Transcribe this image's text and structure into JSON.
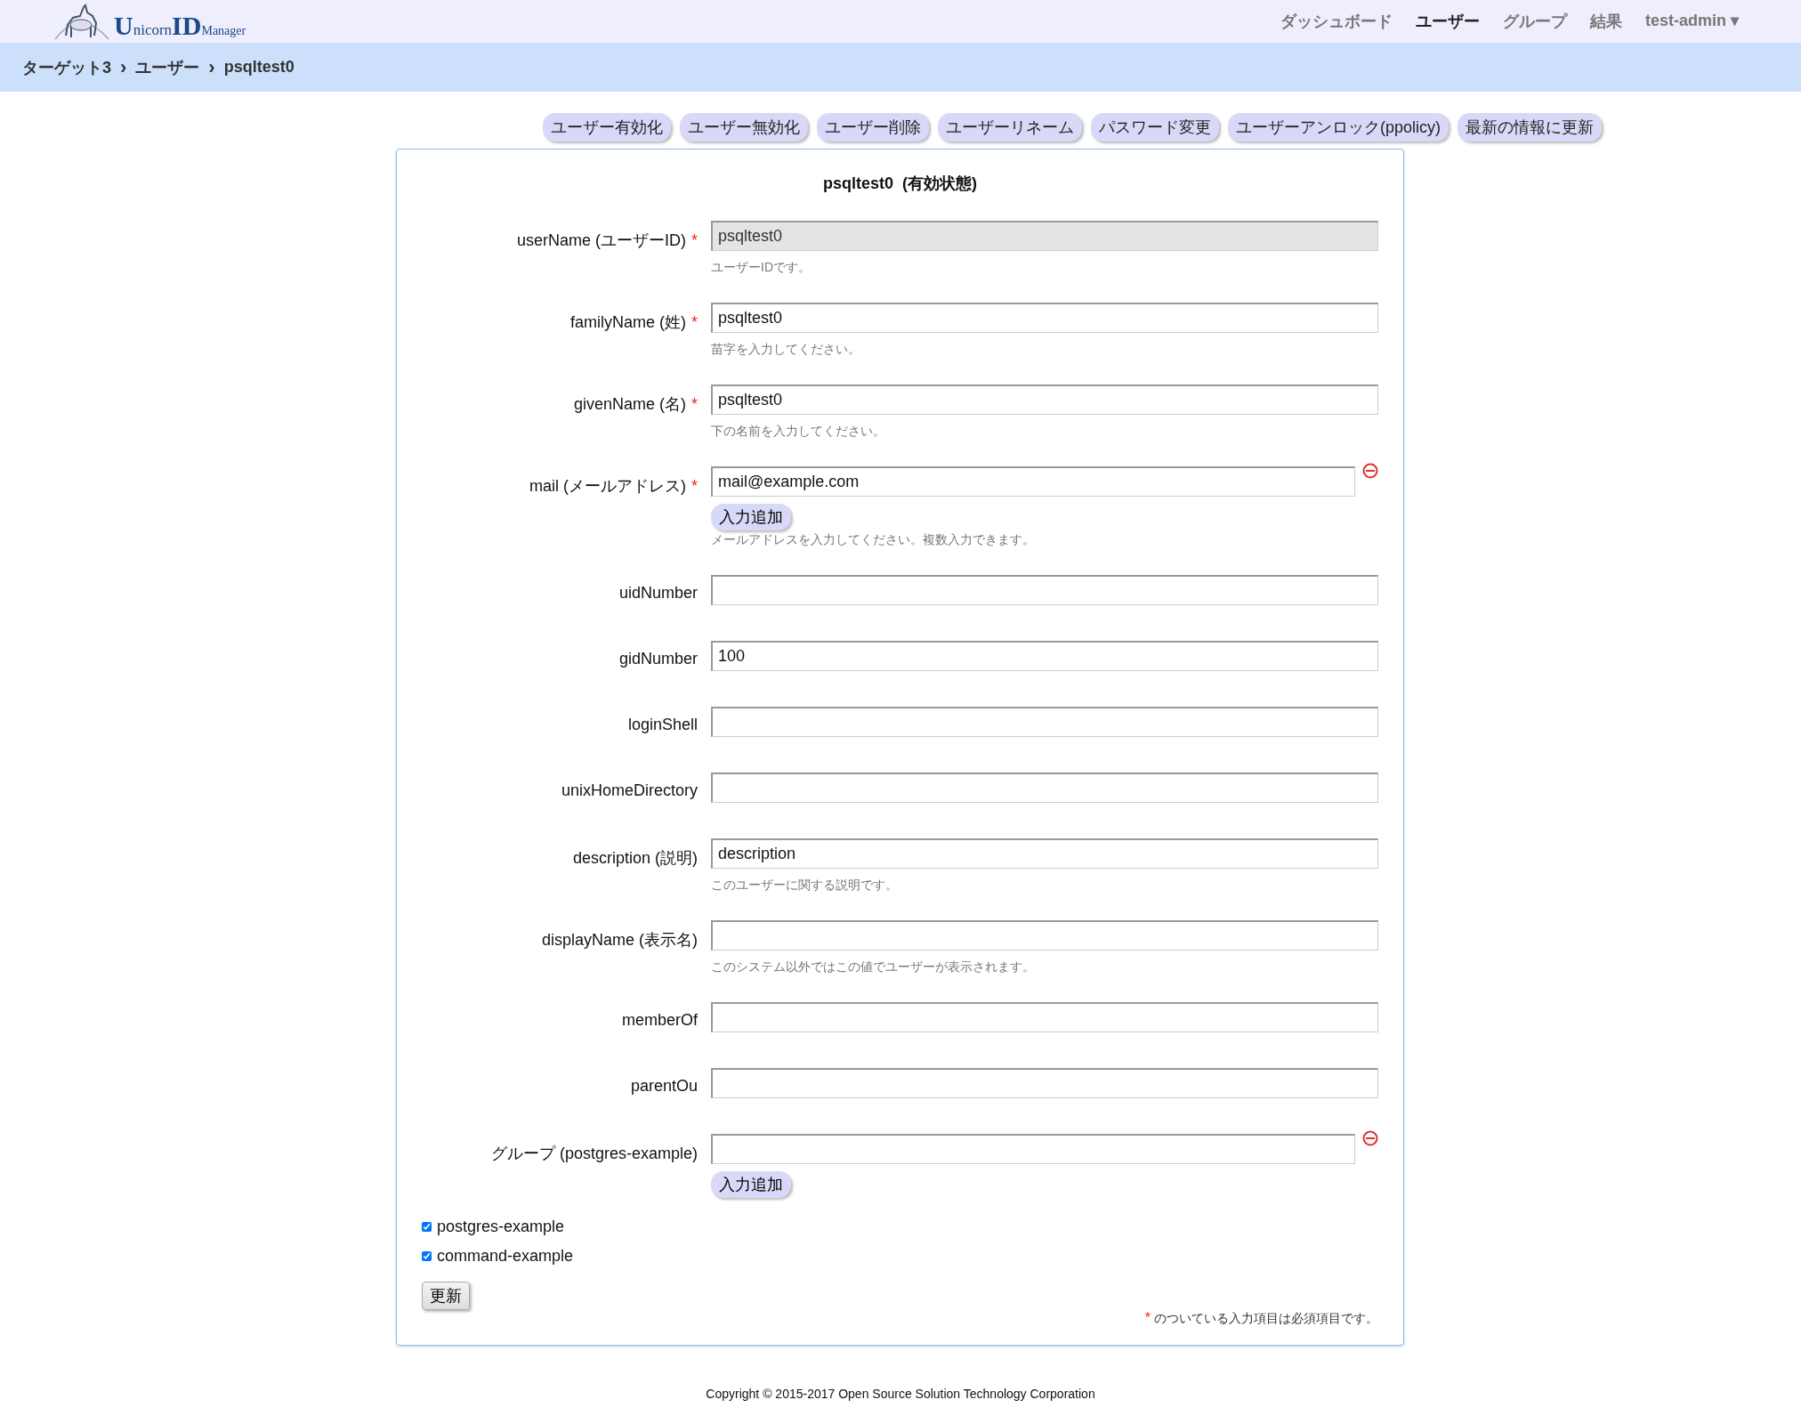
{
  "header": {
    "logo": {
      "parts": [
        "U",
        "nicorn",
        "ID",
        "Manager"
      ]
    },
    "nav": [
      {
        "label": "ダッシュボード",
        "selected": false
      },
      {
        "label": "ユーザー",
        "selected": true
      },
      {
        "label": "グループ",
        "selected": false
      },
      {
        "label": "結果",
        "selected": false
      },
      {
        "label": "test-admin ▾",
        "selected": false
      }
    ]
  },
  "breadcrumb": [
    {
      "label": "ターゲット3",
      "sep": "›"
    },
    {
      "label": "ユーザー",
      "sep": "›"
    },
    {
      "label": "psqltest0"
    }
  ],
  "actions": [
    "ユーザー有効化",
    "ユーザー無効化",
    "ユーザー削除",
    "ユーザーリネーム",
    "パスワード変更",
    "ユーザーアンロック(ppolicy)",
    "最新の情報に更新"
  ],
  "form": {
    "title": "psqltest0  (有効状態)",
    "fields": [
      {
        "kind": "input",
        "label": "userName (ユーザーID)",
        "required": true,
        "disabled": true,
        "value": "psqltest0",
        "hint": "ユーザーIDです。"
      },
      {
        "kind": "input",
        "label": "familyName (姓)",
        "required": true,
        "disabled": false,
        "value": "psqltest0",
        "hint": "苗字を入力してください。"
      },
      {
        "kind": "input",
        "label": "givenName (名)",
        "required": true,
        "disabled": false,
        "value": "psqltest0",
        "hint": "下の名前を入力してください。"
      },
      {
        "kind": "multi",
        "label": "mail (メールアドレス)",
        "required": true,
        "disabled": false,
        "value": "mail@example.com",
        "add": "入力追加",
        "hint": "メールアドレスを入力してください。複数入力できます。"
      },
      {
        "kind": "input",
        "label": "uidNumber",
        "required": false,
        "disabled": false
      },
      {
        "kind": "input",
        "label": "gidNumber",
        "required": false,
        "disabled": false,
        "value": "100"
      },
      {
        "kind": "input",
        "label": "loginShell",
        "required": false,
        "disabled": false
      },
      {
        "kind": "input",
        "label": "unixHomeDirectory",
        "required": false,
        "disabled": false
      },
      {
        "kind": "input",
        "label": "description (説明)",
        "required": false,
        "disabled": false,
        "value": "description",
        "hint": "このユーザーに関する説明です。"
      },
      {
        "kind": "input",
        "label": "displayName (表示名)",
        "required": false,
        "disabled": false,
        "hint": "このシステム以外ではこの値でユーザーが表示されます。"
      },
      {
        "kind": "input",
        "label": "memberOf",
        "required": false,
        "disabled": false
      },
      {
        "kind": "input",
        "label": "parentOu",
        "required": false,
        "disabled": false
      },
      {
        "kind": "multi",
        "label": "グループ (postgres-example)",
        "required": false,
        "disabled": false,
        "add": "入力追加"
      }
    ],
    "checkboxes": [
      {
        "label": "postgres-example",
        "checked": true
      },
      {
        "label": "command-example",
        "checked": true
      }
    ],
    "submit": "更新",
    "note": {
      "mark": "*",
      "text": "のついている入力項目は必須項目です。"
    }
  },
  "footer": "Copyright © 2015-2017 Open Source Solution Technology Corporation"
}
